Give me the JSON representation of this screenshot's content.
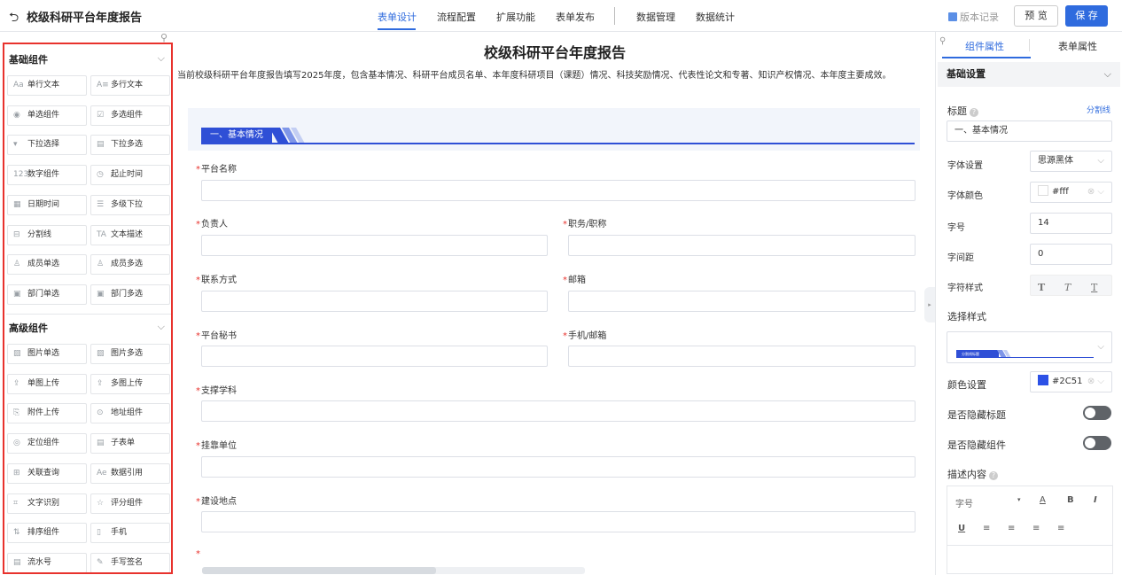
{
  "header": {
    "back_icon": "back-arrow-icon",
    "title": "校级科研平台年度报告",
    "nav": [
      "表单设计",
      "流程配置",
      "扩展功能",
      "表单发布",
      "数据管理",
      "数据统计"
    ],
    "active_nav": "表单设计",
    "version_label": "版本记录",
    "preview_label": "预 览",
    "save_label": "保 存",
    "accent": "#2f6bde"
  },
  "left": {
    "basic": {
      "title": "基础组件",
      "items": [
        {
          "icon": "Aa",
          "label": "单行文本"
        },
        {
          "icon": "A≡",
          "label": "多行文本"
        },
        {
          "icon": "◉",
          "label": "单选组件"
        },
        {
          "icon": "☑",
          "label": "多选组件"
        },
        {
          "icon": "▾",
          "label": "下拉选择"
        },
        {
          "icon": "▤",
          "label": "下拉多选"
        },
        {
          "icon": "123",
          "label": "数字组件"
        },
        {
          "icon": "◷",
          "label": "起止时间"
        },
        {
          "icon": "▦",
          "label": "日期时间"
        },
        {
          "icon": "☰",
          "label": "多级下拉"
        },
        {
          "icon": "⊟",
          "label": "分割线"
        },
        {
          "icon": "TA",
          "label": "文本描述"
        },
        {
          "icon": "♙",
          "label": "成员单选"
        },
        {
          "icon": "♙",
          "label": "成员多选"
        },
        {
          "icon": "▣",
          "label": "部门单选"
        },
        {
          "icon": "▣",
          "label": "部门多选"
        }
      ]
    },
    "advanced": {
      "title": "高级组件",
      "items": [
        {
          "icon": "▨",
          "label": "图片单选"
        },
        {
          "icon": "▨",
          "label": "图片多选"
        },
        {
          "icon": "⇪",
          "label": "单图上传"
        },
        {
          "icon": "⇪",
          "label": "多图上传"
        },
        {
          "icon": "⎘",
          "label": "附件上传"
        },
        {
          "icon": "⊙",
          "label": "地址组件"
        },
        {
          "icon": "◎",
          "label": "定位组件"
        },
        {
          "icon": "▤",
          "label": "子表单"
        },
        {
          "icon": "⊞",
          "label": "关联查询"
        },
        {
          "icon": "Ae",
          "label": "数据引用"
        },
        {
          "icon": "⌗",
          "label": "文字识别"
        },
        {
          "icon": "☆",
          "label": "评分组件"
        },
        {
          "icon": "⇅",
          "label": "排序组件"
        },
        {
          "icon": "▯",
          "label": "手机"
        },
        {
          "icon": "▤",
          "label": "流水号"
        },
        {
          "icon": "✎",
          "label": "手写签名"
        }
      ]
    }
  },
  "form": {
    "title": "校级科研平台年度报告",
    "description": "当前校级科研平台年度报告填写2025年度，包含基本情况、科研平台成员名单、本年度科研项目（课题）情况、科技奖励情况、代表性论文和专著、知识产权情况、本年度主要成效。",
    "section_label": "一、基本情况",
    "fields": {
      "platform_name": "平台名称",
      "leader": "负责人",
      "title_rank": "职务/职称",
      "contact": "联系方式",
      "email": "邮箱",
      "secretary": "平台秘书",
      "phone_email": "手机/邮箱",
      "discipline": "支撑学科",
      "affiliation": "挂靠单位",
      "location": "建设地点"
    },
    "required_mark": "*"
  },
  "right": {
    "tabs": [
      "组件属性",
      "表单属性"
    ],
    "active_tab": "组件属性",
    "basic_settings": "基础设置",
    "title_label": "标题",
    "divider_link": "分割线",
    "title_value": "一、基本情况",
    "font_label": "字体设置",
    "font_value": "思源黑体",
    "font_color_label": "字体颜色",
    "font_color_value": "#fff",
    "font_size_label": "字号",
    "font_size_value": "14",
    "letter_spacing_label": "字间距",
    "letter_spacing_value": "0",
    "char_style_label": "字符样式",
    "char_styles": [
      "T",
      "T",
      "T"
    ],
    "select_style_label": "选择样式",
    "style_preview_text": "分割线标题",
    "color_label": "颜色设置",
    "color_value": "#2C51",
    "swatch_color": "#2c51e6",
    "hide_title_label": "是否隐藏标题",
    "hide_component_label": "是否隐藏组件",
    "desc_label": "描述内容",
    "rich_font_size": "字号",
    "rich_tools_row1": [
      "A",
      "B",
      "I"
    ],
    "rich_tools_row2": [
      "U",
      "≡",
      "≡",
      "≡",
      "≡"
    ]
  }
}
